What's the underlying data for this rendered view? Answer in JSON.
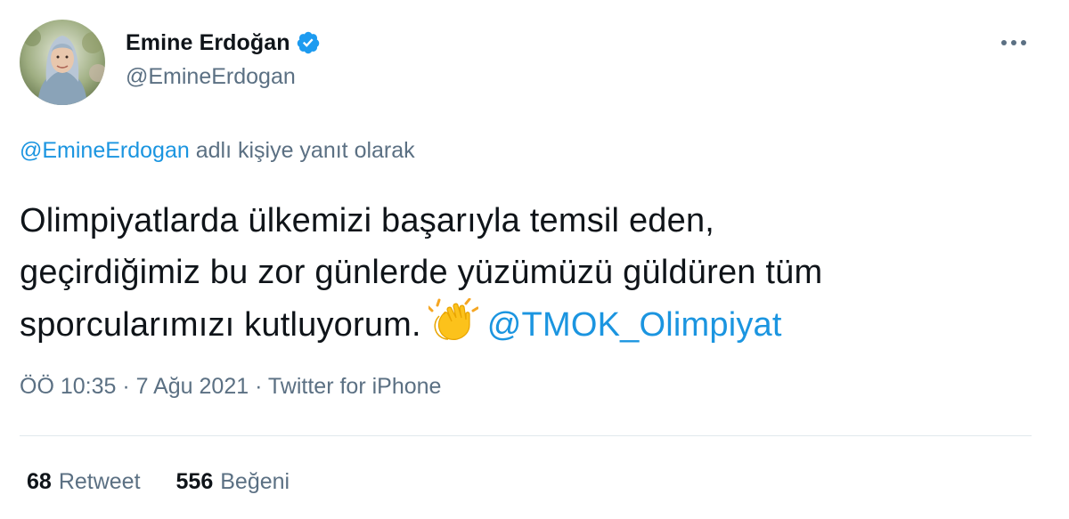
{
  "author": {
    "display_name": "Emine Erdoğan",
    "handle": "@EmineErdogan",
    "verified": true
  },
  "reply_context": {
    "mention": "@EmineErdogan",
    "text": " adlı kişiye yanıt olarak"
  },
  "tweet": {
    "lines": [
      "Olimpiyatlarda ülkemizi başarıyla temsil eden,",
      "geçirdiğimiz bu zor günlerde yüzümüzü güldüren tüm",
      "sporcularımızı kutluyorum."
    ],
    "emoji": "clapping-hands",
    "mention": "@TMOK_Olimpiyat"
  },
  "meta": {
    "time": "ÖÖ 10:35",
    "separator": " · ",
    "date": "7 Ağu 2021",
    "source": "Twitter for iPhone"
  },
  "stats": {
    "retweets_count": "68",
    "retweets_label": "Retweet",
    "likes_count": "556",
    "likes_label": "Beğeni"
  },
  "colors": {
    "link": "#1b95e0",
    "secondary_text": "#5b7083",
    "primary_text": "#0f1419",
    "verified_badge": "#1d9bf0",
    "divider": "#e1e8ed"
  }
}
